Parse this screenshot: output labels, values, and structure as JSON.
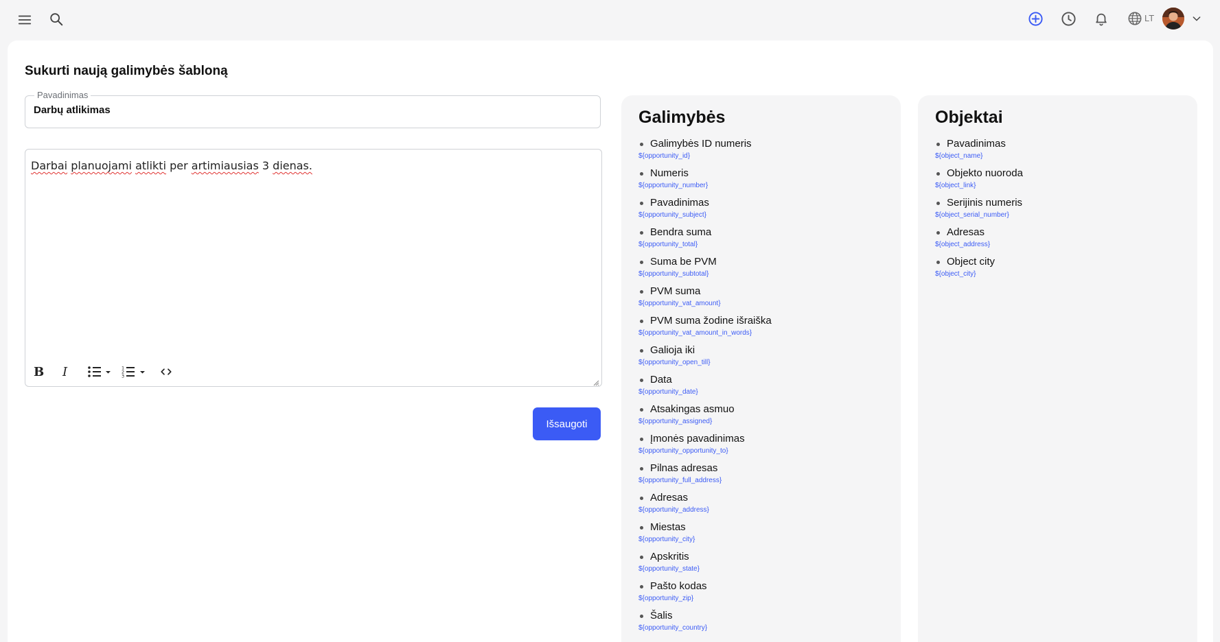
{
  "header": {
    "language": "LT",
    "icons": [
      "menu-icon",
      "search-icon",
      "add-circle-icon",
      "history-icon",
      "bell-icon",
      "globe-icon",
      "chevron-down-icon"
    ]
  },
  "page": {
    "title": "Sukurti naują galimybės šabloną"
  },
  "form": {
    "name_label": "Pavadinimas",
    "name_value": "Darbų atlikimas",
    "editor": {
      "words": [
        "Darbai",
        "planuojami",
        "atlikti",
        "per",
        "artimiausias",
        "3",
        "dienas."
      ],
      "spellcheck": [
        true,
        true,
        true,
        false,
        true,
        false,
        true
      ]
    },
    "save_label": "Išsaugoti"
  },
  "opportunities": {
    "title": "Galimybės",
    "items": [
      {
        "label": "Galimybės ID numeris",
        "token": "${opportunity_id}"
      },
      {
        "label": "Numeris",
        "token": "${opportunity_number}"
      },
      {
        "label": "Pavadinimas",
        "token": "${opportunity_subject}"
      },
      {
        "label": "Bendra suma",
        "token": "${opportunity_total}"
      },
      {
        "label": "Suma be PVM",
        "token": "${opportunity_subtotal}"
      },
      {
        "label": "PVM suma",
        "token": "${opportunity_vat_amount}"
      },
      {
        "label": "PVM suma žodine išraiška",
        "token": "${opportunity_vat_amount_in_words}"
      },
      {
        "label": "Galioja iki",
        "token": "${opportunity_open_till}"
      },
      {
        "label": "Data",
        "token": "${opportunity_date}"
      },
      {
        "label": "Atsakingas asmuo",
        "token": "${opportunity_assigned}"
      },
      {
        "label": "Įmonės pavadinimas",
        "token": "${opportunity_opportunity_to}"
      },
      {
        "label": "Pilnas adresas",
        "token": "${opportunity_full_address}"
      },
      {
        "label": "Adresas",
        "token": "${opportunity_address}"
      },
      {
        "label": "Miestas",
        "token": "${opportunity_city}"
      },
      {
        "label": "Apskritis",
        "token": "${opportunity_state}"
      },
      {
        "label": "Pašto kodas",
        "token": "${opportunity_zip}"
      },
      {
        "label": "Šalis",
        "token": "${opportunity_country}"
      }
    ]
  },
  "objects": {
    "title": "Objektai",
    "items": [
      {
        "label": "Pavadinimas",
        "token": "${object_name}"
      },
      {
        "label": "Objekto nuoroda",
        "token": "${object_link}"
      },
      {
        "label": "Serijinis numeris",
        "token": "${object_serial_number}"
      },
      {
        "label": "Adresas",
        "token": "${object_address}"
      },
      {
        "label": "Object city",
        "token": "${object_city}"
      }
    ]
  },
  "colors": {
    "accent": "#3b5bf5",
    "panel_bg": "#f5f5f6",
    "spell_underline": "#e0312f"
  }
}
